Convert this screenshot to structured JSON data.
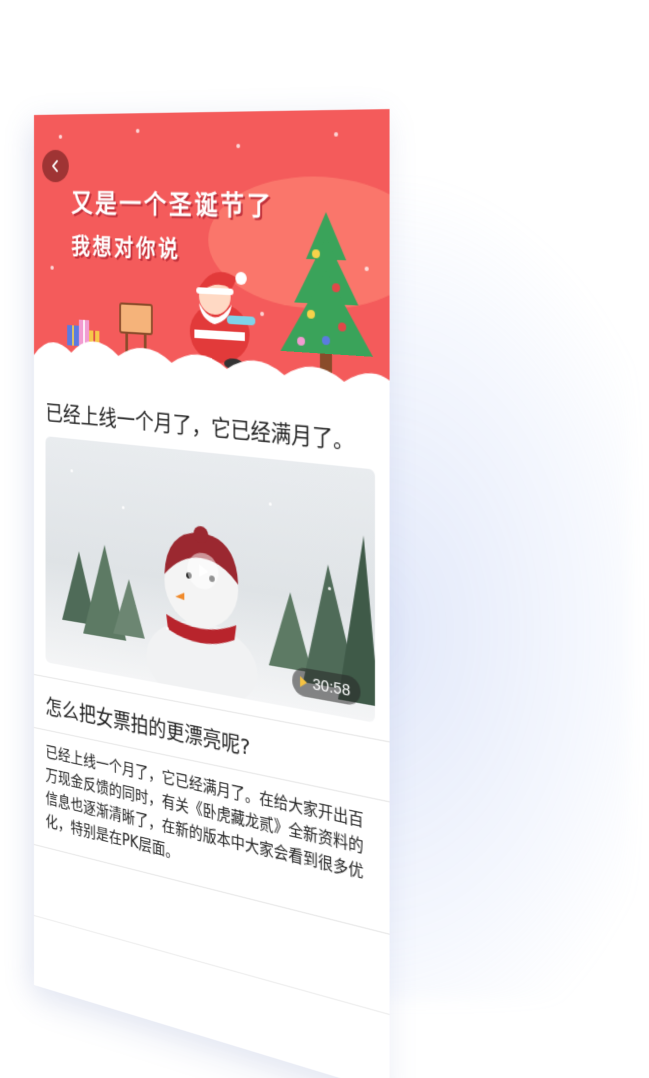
{
  "banner": {
    "title": "又是一个圣诞节了",
    "subtitle": "我想对你说",
    "background_color": "#f45b5b"
  },
  "nav": {
    "back_icon": "chevron-left-icon"
  },
  "article1": {
    "title": "已经上线一个月了，它已经满月了。"
  },
  "video": {
    "duration": "30:58",
    "play_icon": "play-icon"
  },
  "article2": {
    "title": "怎么把女票拍的更漂亮呢?",
    "body": "已经上线一个月了，它已经满月了。在给大家开出百万现金反馈的同时，有关《卧虎藏龙贰》全新资料的信息也逐渐清晰了，在新的版本中大家会看到很多优化，特别是在PK层面。"
  }
}
